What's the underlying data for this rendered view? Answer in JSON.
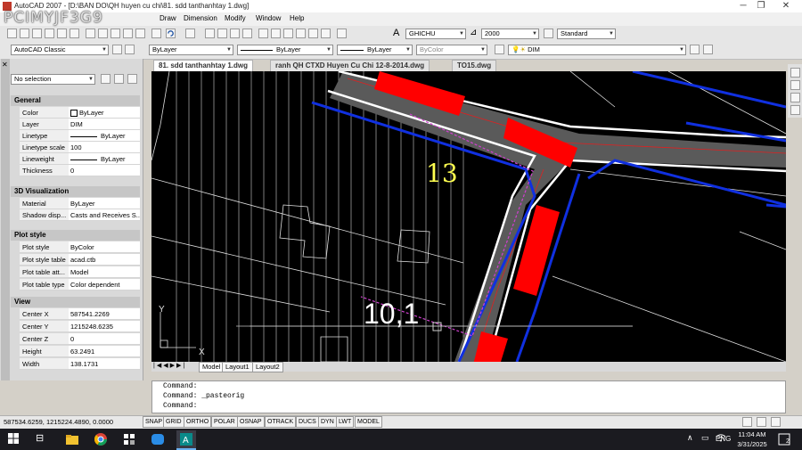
{
  "window": {
    "title": "AutoCAD 2007 - [D:\\BAN DO\\QH huyen cu chi\\81. sdd tanthanhtay 1.dwg]",
    "watermark": "PCIMYJF3G9"
  },
  "menu": [
    "Draw",
    "Dimension",
    "Modify",
    "Window",
    "Help"
  ],
  "toolbar": {
    "workspace": "AutoCAD Classic",
    "textstyle": "GHICHU",
    "dimscale": "2000",
    "tablestyle": "Standard",
    "color": "ByLayer",
    "linetype": "ByLayer",
    "lineweight": "ByLayer",
    "plotstyle": "ByColor",
    "layer": "DIM"
  },
  "palette": {
    "selection": "No selection",
    "sections": [
      {
        "title": "General",
        "rows": [
          [
            "Color",
            "ByLayer"
          ],
          [
            "Layer",
            "DIM"
          ],
          [
            "Linetype",
            "ByLayer"
          ],
          [
            "Linetype scale",
            "100"
          ],
          [
            "Lineweight",
            "ByLayer"
          ],
          [
            "Thickness",
            "0"
          ]
        ]
      },
      {
        "title": "3D Visualization",
        "rows": [
          [
            "Material",
            "ByLayer"
          ],
          [
            "Shadow disp...",
            "Casts and Receives S..."
          ]
        ]
      },
      {
        "title": "Plot style",
        "rows": [
          [
            "Plot style",
            "ByColor"
          ],
          [
            "Plot style table",
            "acad.ctb"
          ],
          [
            "Plot table att...",
            "Model"
          ],
          [
            "Plot table type",
            "Color dependent"
          ]
        ]
      },
      {
        "title": "View",
        "rows": [
          [
            "Center X",
            "587541.2269"
          ],
          [
            "Center Y",
            "1215248.6235"
          ],
          [
            "Center Z",
            "0"
          ],
          [
            "Height",
            "63.2491"
          ],
          [
            "Width",
            "138.1731"
          ]
        ]
      }
    ]
  },
  "tabs": [
    "81. sdd tanthanhtay 1.dwg",
    "ranh QH CTXD Huyen Cu Chi 12-8-2014.dwg",
    "TO15.dwg"
  ],
  "drawing": {
    "lot_number": "13",
    "dimension_text": "10,1",
    "axis_x": "X",
    "axis_y": "Y"
  },
  "layout_tabs": [
    "Model",
    "Layout1",
    "Layout2"
  ],
  "command_lines": [
    "Command:",
    "Command:  _pasteorig",
    "Command:"
  ],
  "status": {
    "coords": "587534.6259, 1215224.4890, 0.0000",
    "buttons": [
      "SNAP",
      "GRID",
      "ORTHO",
      "POLAR",
      "OSNAP",
      "OTRACK",
      "DUCS",
      "DYN",
      "LWT",
      "MODEL"
    ]
  },
  "taskbar": {
    "lang": "ENG",
    "time": "11:04 AM",
    "date": "3/31/2025",
    "notif": "2"
  },
  "colors": {
    "canvas_bg": "#000000",
    "accent": "#0078d7"
  }
}
